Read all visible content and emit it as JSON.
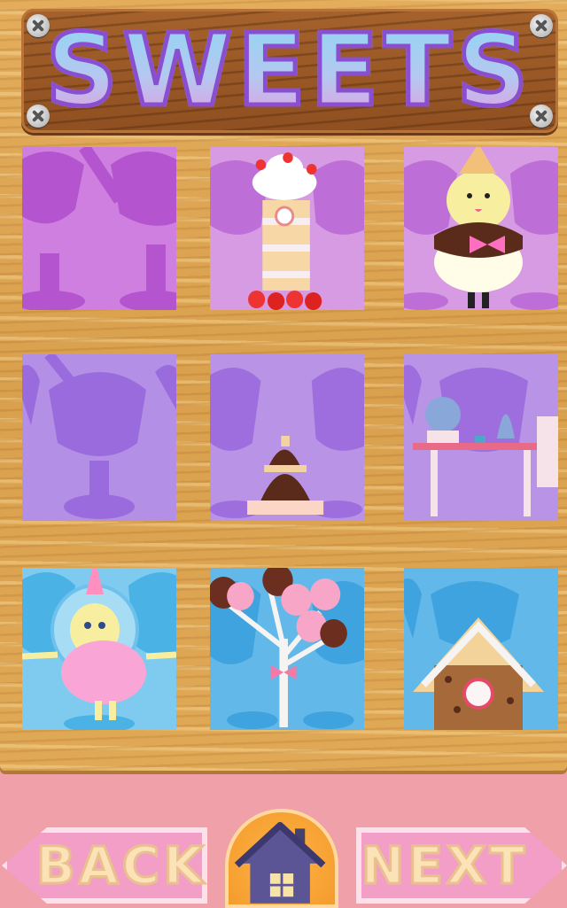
{
  "screen": {
    "title": "SWEETS",
    "colors": {
      "board": "#dba352",
      "plaque": "#9a5826",
      "title_fill_top": "#8fd6f4",
      "title_fill_bottom": "#e69ae0",
      "title_stroke": "#8a4fd0",
      "bar": "#f0a0a8",
      "button_pink": "#f29ec6",
      "button_text": "#fbe3b7",
      "home_orange": "#f7a63a"
    }
  },
  "grid": {
    "tiles": [
      {
        "id": "tile-1",
        "name": "locked-sundae",
        "state": "locked",
        "bg": "#cf7fe0",
        "silhouette": "#b455cf"
      },
      {
        "id": "tile-2",
        "name": "strawberry-cake-tower",
        "state": "unlocked",
        "bg": "#d69be3",
        "silhouette": "#bd6fd7"
      },
      {
        "id": "tile-3",
        "name": "ice-cream-cone-character",
        "state": "unlocked",
        "bg": "#d69be3",
        "silhouette": "#bd6fd7"
      },
      {
        "id": "tile-4",
        "name": "locked-sundae",
        "state": "locked",
        "bg": "#b38fe6",
        "silhouette": "#9a6bdc"
      },
      {
        "id": "tile-5",
        "name": "chocolate-layer-cake",
        "state": "unlocked",
        "bg": "#b994e6",
        "silhouette": "#9e6ede"
      },
      {
        "id": "tile-6",
        "name": "candy-table-scene",
        "state": "unlocked",
        "bg": "#b994e6",
        "silhouette": "#9e6ede"
      },
      {
        "id": "tile-7",
        "name": "cotton-candy-character",
        "state": "unlocked",
        "bg": "#7fcbef",
        "silhouette": "#4ab2e4"
      },
      {
        "id": "tile-8",
        "name": "cake-pop-tree",
        "state": "unlocked",
        "bg": "#62b9e9",
        "silhouette": "#3ea3de"
      },
      {
        "id": "tile-9",
        "name": "gingerbread-house",
        "state": "unlocked",
        "bg": "#62b9e9",
        "silhouette": "#3ea3de"
      }
    ]
  },
  "nav": {
    "back_label": "BACK",
    "next_label": "NEXT",
    "home_icon": "house-icon"
  }
}
